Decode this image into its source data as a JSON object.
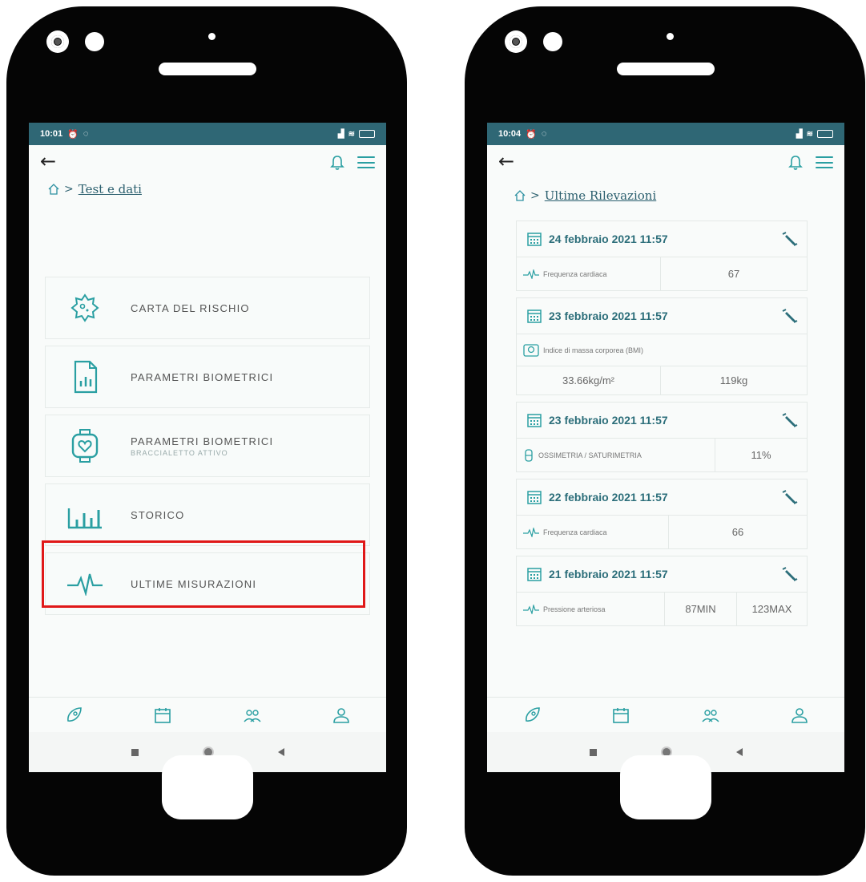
{
  "left_phone": {
    "status_time": "10:01",
    "breadcrumb": "Test e dati",
    "menu_items": [
      {
        "label": "CARTA DEL RISCHIO",
        "sub": "",
        "icon": "virus-icon"
      },
      {
        "label": "PARAMETRI BIOMETRICI",
        "sub": "",
        "icon": "document-chart-icon"
      },
      {
        "label": "PARAMETRI BIOMETRICI",
        "sub": "BRACCIALETTO ATTIVO",
        "icon": "smartwatch-heart-icon"
      },
      {
        "label": "STORICO",
        "sub": "",
        "icon": "bar-chart-icon"
      },
      {
        "label": "ULTIME MISURAZIONI",
        "sub": "",
        "icon": "pulse-icon"
      }
    ],
    "highlighted_item": "ULTIME MISURAZIONI",
    "highlight_color": "#e01818"
  },
  "right_phone": {
    "status_time": "10:04",
    "breadcrumb": "Ultime Rilevazioni",
    "records": [
      {
        "date": "24 febbraio 2021 11:57",
        "measure": "Frequenza cardiaca",
        "values": [
          "67"
        ]
      },
      {
        "date": "23 febbraio 2021 11:57",
        "measure": "Indice di massa corporea (BMI)",
        "values": [
          "33.66kg/m²",
          "119kg"
        ]
      },
      {
        "date": "23 febbraio 2021 11:57",
        "measure": "OSSIMETRIA / SATURIMETRIA",
        "values": [
          "11%"
        ]
      },
      {
        "date": "22 febbraio 2021 11:57",
        "measure": "Frequenza cardiaca",
        "values": [
          "66"
        ]
      },
      {
        "date": "21 febbraio 2021 11:57",
        "measure": "Pressione arteriosa",
        "values": [
          "87MIN",
          "123MAX"
        ]
      }
    ]
  },
  "colors": {
    "status_bar": "#2f6775",
    "accent": "#2a9fa2",
    "date_text": "#2c6e7a"
  }
}
